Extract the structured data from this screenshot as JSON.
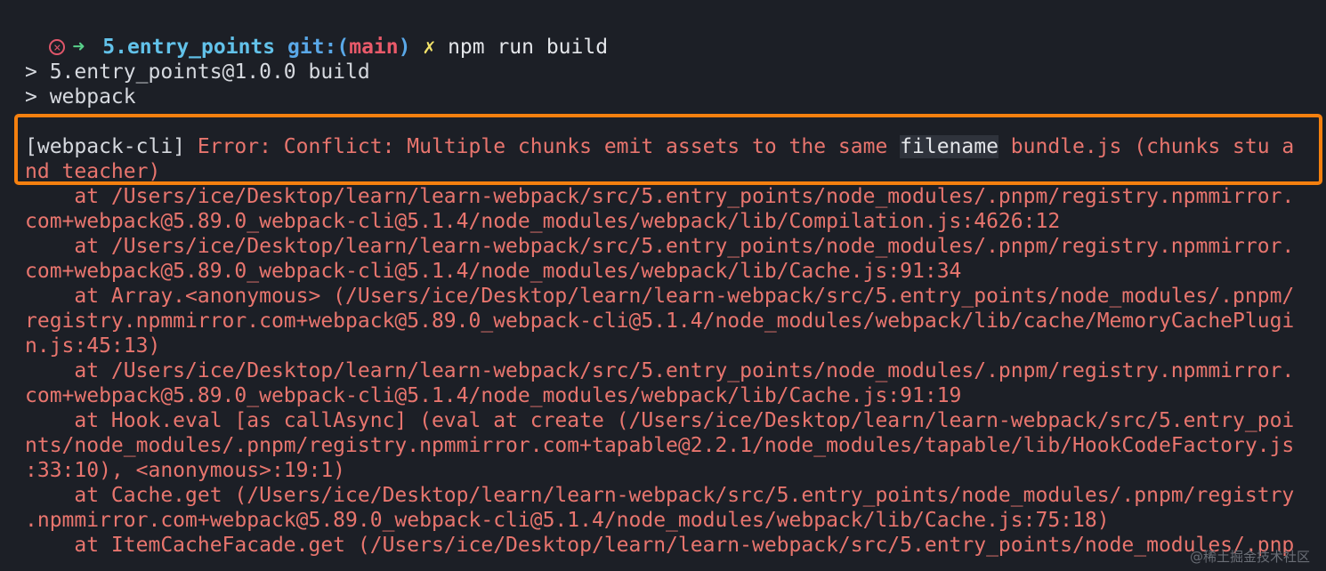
{
  "prompt": {
    "status_icon": "error-circle-x-icon",
    "arrow": "➜",
    "directory": "5.entry_points",
    "git_label": "git:",
    "branch_open": "(",
    "branch": "main",
    "branch_close": ")",
    "dirty_marker": "✗",
    "command": "npm run build"
  },
  "script_output": [
    "> 5.entry_points@1.0.0 build",
    "> webpack"
  ],
  "error": {
    "line1_prefix": "[webpack-cli]",
    "line1_message": " Error: Conflict: Multiple chunks emit assets to the same ",
    "line1_highlight": "filename",
    "line1_suffix": " bundle.js (chunks stu a",
    "line2": "nd teacher)"
  },
  "stack": [
    "    at /Users/ice/Desktop/learn/learn-webpack/src/5.entry_points/node_modules/.pnpm/registry.npmmirror.",
    "com+webpack@5.89.0_webpack-cli@5.1.4/node_modules/webpack/lib/Compilation.js:4626:12",
    "    at /Users/ice/Desktop/learn/learn-webpack/src/5.entry_points/node_modules/.pnpm/registry.npmmirror.",
    "com+webpack@5.89.0_webpack-cli@5.1.4/node_modules/webpack/lib/Cache.js:91:34",
    "    at Array.<anonymous> (/Users/ice/Desktop/learn/learn-webpack/src/5.entry_points/node_modules/.pnpm/",
    "registry.npmmirror.com+webpack@5.89.0_webpack-cli@5.1.4/node_modules/webpack/lib/cache/MemoryCachePlugi",
    "n.js:45:13)",
    "    at /Users/ice/Desktop/learn/learn-webpack/src/5.entry_points/node_modules/.pnpm/registry.npmmirror.",
    "com+webpack@5.89.0_webpack-cli@5.1.4/node_modules/webpack/lib/Cache.js:91:19",
    "    at Hook.eval [as callAsync] (eval at create (/Users/ice/Desktop/learn/learn-webpack/src/5.entry_poi",
    "nts/node_modules/.pnpm/registry.npmmirror.com+tapable@2.2.1/node_modules/tapable/lib/HookCodeFactory.js",
    ":33:10), <anonymous>:19:1)",
    "    at Cache.get (/Users/ice/Desktop/learn/learn-webpack/src/5.entry_points/node_modules/.pnpm/registry",
    ".npmmirror.com+webpack@5.89.0_webpack-cli@5.1.4/node_modules/webpack/lib/Cache.js:75:18)",
    "    at ItemCacheFacade.get (/Users/ice/Desktop/learn/learn-webpack/src/5.entry_points/node_modules/.pnp"
  ],
  "watermark": "@稀土掘金技术社区",
  "colors": {
    "background": "#1c1f26",
    "error_text": "#e8756e",
    "highlight_box": "#f5800f",
    "directory": "#62c2ea",
    "branch": "#ea5a6a"
  }
}
